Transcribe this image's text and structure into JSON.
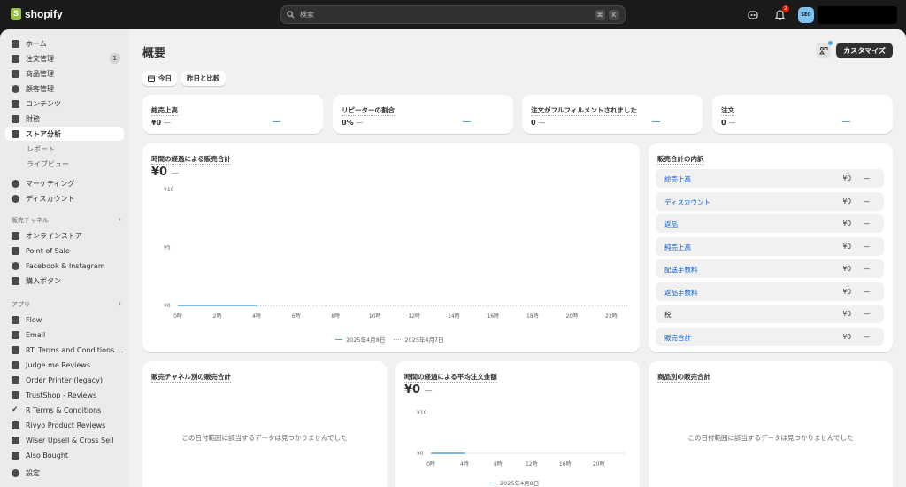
{
  "topbar": {
    "brand": "shopify",
    "search_placeholder": "検索",
    "shortcut_keys": [
      "⌘",
      "K"
    ],
    "notification_count": "2",
    "avatar_initials": "SEO"
  },
  "sidebar": {
    "items": [
      {
        "label": "ホーム",
        "icon": "home-icon"
      },
      {
        "label": "注文管理",
        "icon": "inbox-icon",
        "count": "1"
      },
      {
        "label": "商品管理",
        "icon": "tag-icon"
      },
      {
        "label": "顧客管理",
        "icon": "person-icon"
      },
      {
        "label": "コンテンツ",
        "icon": "content-icon"
      },
      {
        "label": "財務",
        "icon": "bank-icon"
      },
      {
        "label": "ストア分析",
        "icon": "chart-icon",
        "active": true
      },
      {
        "label": "レポート",
        "sub": true
      },
      {
        "label": "ライブビュー",
        "sub": true
      },
      {
        "label": "マーケティング",
        "icon": "target-icon"
      },
      {
        "label": "ディスカウント",
        "icon": "discount-icon"
      }
    ],
    "sales_channels_header": "販売チャネル",
    "channels": [
      {
        "label": "オンラインストア",
        "icon": "store-icon"
      },
      {
        "label": "Point of Sale",
        "icon": "pos-icon"
      },
      {
        "label": "Facebook & Instagram",
        "icon": "meta-icon"
      },
      {
        "label": "購入ボタン",
        "icon": "buy-button-icon"
      }
    ],
    "apps_header": "アプリ",
    "apps": [
      {
        "label": "Flow",
        "icon": "flow-icon"
      },
      {
        "label": "Email",
        "icon": "email-icon"
      },
      {
        "label": "RT: Terms and Conditions ...",
        "icon": "rt-icon"
      },
      {
        "label": "Judge.me Reviews",
        "icon": "judgeme-icon"
      },
      {
        "label": "Order Printer (legacy)",
        "icon": "printer-icon"
      },
      {
        "label": "TrustShop - Reviews",
        "icon": "trustshop-icon"
      },
      {
        "label": "R Terms & Conditions",
        "icon": "check-icon"
      },
      {
        "label": "Rivyo Product Reviews",
        "icon": "rivyo-icon"
      },
      {
        "label": "Wiser Upsell & Cross Sell",
        "icon": "wiser-icon"
      },
      {
        "label": "Also Bought",
        "icon": "alsobought-icon"
      }
    ],
    "settings_label": "設定"
  },
  "main": {
    "title": "概要",
    "customize_label": "カスタマイズ",
    "date_button": "今日",
    "compare_button": "昨日と比較",
    "metrics": [
      {
        "title": "総売上高",
        "value": "¥0",
        "change": "—"
      },
      {
        "title": "リピーターの割合",
        "value": "0%",
        "change": "—"
      },
      {
        "title": "注文がフルフィルメントされました",
        "value": "0",
        "change": "—"
      },
      {
        "title": "注文",
        "value": "0",
        "change": "—"
      }
    ],
    "sales_over_time": {
      "title": "時間の経過による販売合計",
      "value": "¥0",
      "change": "—",
      "legend_current": "2025年4月8日",
      "legend_previous": "2025年4月7日"
    },
    "breakdown": {
      "title": "販売合計の内訳",
      "rows": [
        {
          "label": "総売上高",
          "value": "¥0",
          "change": "—",
          "link": true
        },
        {
          "label": "ディスカウント",
          "value": "¥0",
          "change": "—",
          "link": true
        },
        {
          "label": "返品",
          "value": "¥0",
          "change": "—",
          "link": true
        },
        {
          "label": "純売上高",
          "value": "¥0",
          "change": "—",
          "link": true
        },
        {
          "label": "配送手数料",
          "value": "¥0",
          "change": "—",
          "link": true
        },
        {
          "label": "返品手数料",
          "value": "¥0",
          "change": "—",
          "link": true
        },
        {
          "label": "税",
          "value": "¥0",
          "change": "—",
          "link": false
        },
        {
          "label": "販売合計",
          "value": "¥0",
          "change": "—",
          "link": true
        }
      ]
    },
    "by_channel": {
      "title": "販売チャネル別の販売合計",
      "empty": "この日付範囲に該当するデータは見つかりませんでした"
    },
    "aov": {
      "title": "時間の経過による平均注文金額",
      "value": "¥0",
      "change": "—",
      "legend_current": "2025年4月8日"
    },
    "by_product": {
      "title": "商品別の販売合計",
      "empty": "この日付範囲に該当するデータは見つかりませんでした"
    }
  },
  "chart_data": [
    {
      "type": "line",
      "title": "時間の経過による販売合計",
      "x": [
        "0時",
        "2時",
        "4時",
        "6時",
        "8時",
        "10時",
        "12時",
        "14時",
        "16時",
        "18時",
        "20時",
        "22時"
      ],
      "y_ticks": [
        "¥0",
        "¥5",
        "¥10"
      ],
      "ylim": [
        0,
        10
      ],
      "series": [
        {
          "name": "2025年4月8日",
          "values": [
            0,
            0,
            0
          ]
        },
        {
          "name": "2025年4月7日",
          "values": [
            0,
            0,
            0,
            0,
            0,
            0,
            0,
            0,
            0,
            0,
            0,
            0
          ]
        }
      ],
      "colors": {
        "current": "#4fa3e0",
        "previous": "#b5b5b5"
      }
    },
    {
      "type": "line",
      "title": "時間の経過による平均注文金額",
      "x": [
        "0時",
        "4時",
        "8時",
        "12時",
        "16時",
        "20時"
      ],
      "y_ticks": [
        "¥0",
        "¥10"
      ],
      "ylim": [
        0,
        10
      ],
      "series": [
        {
          "name": "2025年4月8日",
          "values": [
            0,
            0
          ]
        }
      ],
      "colors": {
        "current": "#4fa3e0"
      }
    }
  ]
}
